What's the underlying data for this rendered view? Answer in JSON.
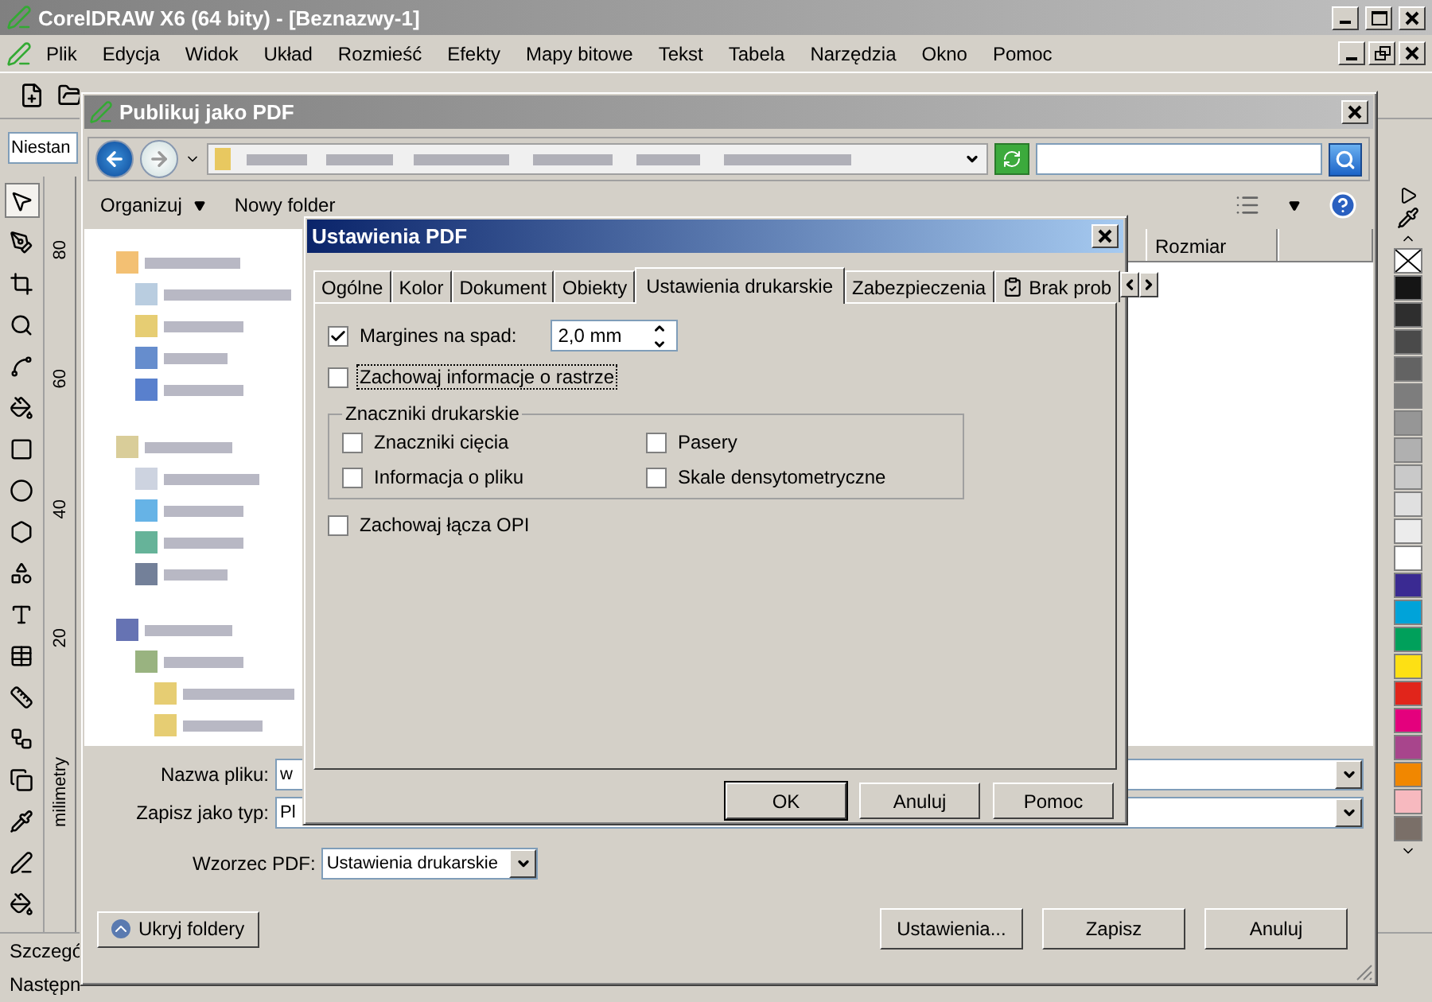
{
  "app_window": {
    "title": "CorelDRAW X6 (64 bity) - [Beznazwy-1]",
    "menu": [
      "Plik",
      "Edycja",
      "Widok",
      "Układ",
      "Rozmieść",
      "Efekty",
      "Mapy bitowe",
      "Tekst",
      "Tabela",
      "Narzędzia",
      "Okno",
      "Pomoc"
    ],
    "property_field": "Niestan",
    "ruler_labels": [
      "80",
      "60",
      "40",
      "20"
    ],
    "ruler_unit": "milimetry",
    "status_lines": [
      "Szczegó",
      "Następn"
    ],
    "palette": [
      {
        "kind": "none"
      },
      {
        "kind": "swatch",
        "color": "#151515"
      },
      {
        "kind": "swatch",
        "color": "#2e2e2e"
      },
      {
        "kind": "swatch",
        "color": "#4a4a4a"
      },
      {
        "kind": "swatch",
        "color": "#636363"
      },
      {
        "kind": "swatch",
        "color": "#7d7d7d"
      },
      {
        "kind": "swatch",
        "color": "#969696"
      },
      {
        "kind": "swatch",
        "color": "#b0b0b0"
      },
      {
        "kind": "swatch",
        "color": "#c9c9c9"
      },
      {
        "kind": "swatch",
        "color": "#e0e0e0"
      },
      {
        "kind": "swatch",
        "color": "#ececec"
      },
      {
        "kind": "swatch",
        "color": "#ffffff"
      },
      {
        "kind": "swatch",
        "color": "#3a2a92"
      },
      {
        "kind": "swatch",
        "color": "#00a3d9"
      },
      {
        "kind": "swatch",
        "color": "#00a05b"
      },
      {
        "kind": "swatch",
        "color": "#fde014"
      },
      {
        "kind": "swatch",
        "color": "#e1251b"
      },
      {
        "kind": "swatch",
        "color": "#e4007d"
      },
      {
        "kind": "swatch",
        "color": "#a8458c"
      },
      {
        "kind": "swatch",
        "color": "#f18700"
      },
      {
        "kind": "swatch",
        "color": "#f7b9bf"
      },
      {
        "kind": "swatch",
        "color": "#7a6f68"
      }
    ]
  },
  "save_dialog": {
    "title": "Publikuj jako PDF",
    "toolbar": [
      "Organizuj",
      "Nowy folder"
    ],
    "columns": [
      "Rozmiar"
    ],
    "file_name": {
      "label": "Nazwa pliku:",
      "value": "w"
    },
    "file_type": {
      "label": "Zapisz jako typ:",
      "value": "Pl"
    },
    "preset": {
      "label": "Wzorzec PDF:",
      "value": "Ustawienia drukarskie"
    },
    "hide_folders": "Ukryj foldery",
    "buttons": [
      "Ustawienia...",
      "Zapisz",
      "Anuluj"
    ]
  },
  "pdf_settings_dialog": {
    "title": "Ustawienia PDF",
    "tabs": [
      {
        "label": "Ogólne",
        "selected": false,
        "kind": "text"
      },
      {
        "label": "Kolor",
        "selected": false,
        "kind": "text"
      },
      {
        "label": "Dokument",
        "selected": false,
        "kind": "text"
      },
      {
        "label": "Obiekty",
        "selected": false,
        "kind": "text"
      },
      {
        "label": "Ustawienia drukarskie",
        "selected": true,
        "kind": "text"
      },
      {
        "label": "Zabezpieczenia",
        "selected": false,
        "kind": "text"
      },
      {
        "label": "Brak prob",
        "selected": false,
        "kind": "icon"
      }
    ],
    "bleed": {
      "label": "Margines na spad:",
      "checked": true,
      "value": "2,0 mm"
    },
    "halftone": {
      "label": "Zachowaj informacje o rastrze",
      "checked": false,
      "focused": true
    },
    "marks_group": {
      "title": "Znaczniki drukarskie",
      "items": [
        {
          "label": "Znaczniki cięcia",
          "checked": false
        },
        {
          "label": "Pasery",
          "checked": false
        },
        {
          "label": "Informacja o pliku",
          "checked": false
        },
        {
          "label": "Skale densytometryczne",
          "checked": false
        }
      ]
    },
    "opi": {
      "label": "Zachowaj łącza OPI",
      "checked": false
    },
    "buttons": [
      {
        "label": "OK",
        "default": true
      },
      {
        "label": "Anuluj",
        "default": false
      },
      {
        "label": "Pomoc",
        "default": false
      }
    ]
  }
}
